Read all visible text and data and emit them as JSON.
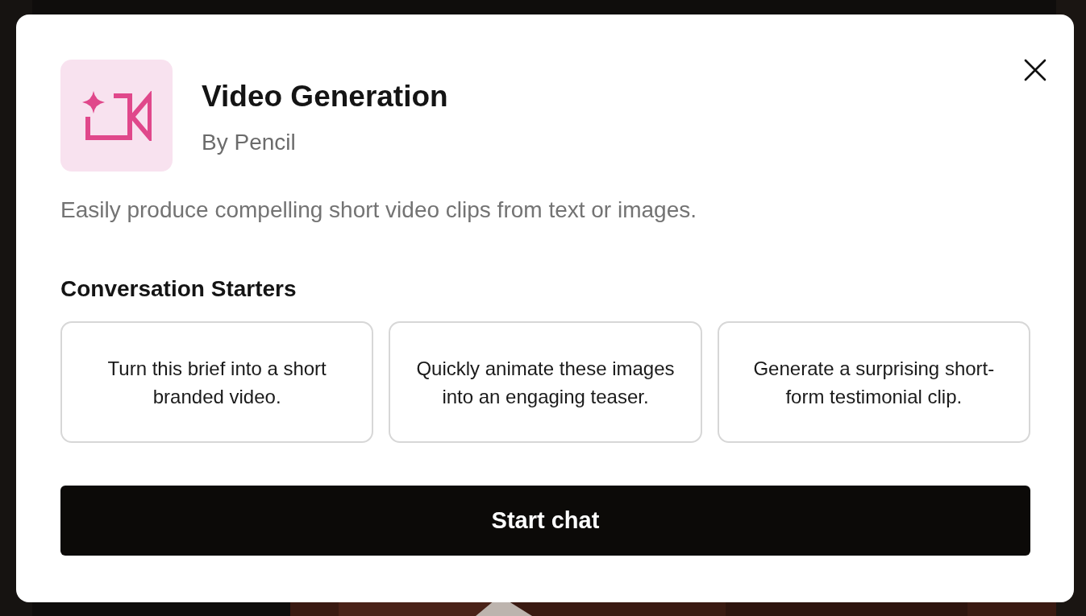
{
  "dialog": {
    "title": "Video Generation",
    "author": "By Pencil",
    "description": "Easily produce compelling short video clips from text or images.",
    "starters_heading": "Conversation Starters",
    "starters": [
      "Turn this brief into a short branded video.",
      "Quickly animate these images into an engaging teaser.",
      "Generate a surprising short-form testimonial clip."
    ],
    "primary_button": "Start chat"
  }
}
